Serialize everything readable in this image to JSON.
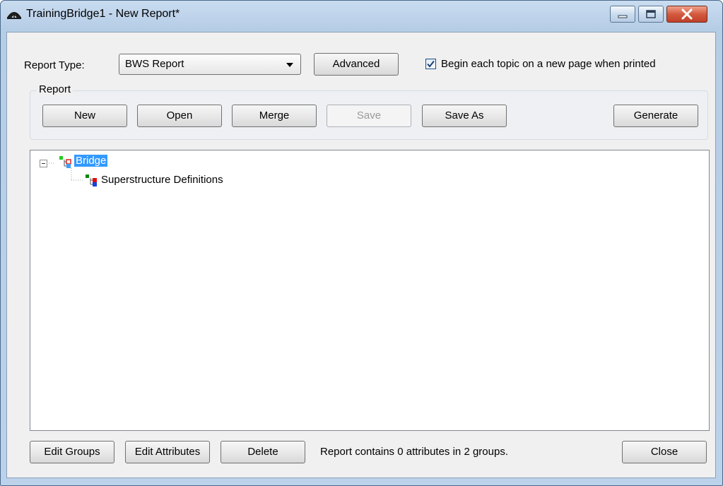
{
  "window": {
    "title": "TrainingBridge1 - New Report*",
    "app_icon": "bridge-arch-icon",
    "controls": [
      "minimize-icon",
      "maximize-icon",
      "close-icon"
    ]
  },
  "report_type": {
    "label": "Report Type:",
    "value": "BWS Report",
    "advanced_label": "Advanced",
    "new_page_checkbox": {
      "label": "Begin each topic on a new page when printed",
      "checked": true
    }
  },
  "report_group": {
    "label": "Report",
    "buttons": {
      "new": "New",
      "open": "Open",
      "merge": "Merge",
      "save": "Save",
      "save_as": "Save As",
      "generate": "Generate"
    },
    "save_enabled": false
  },
  "tree": {
    "root": {
      "label": "Bridge",
      "expanded": true,
      "selected": true,
      "icon": "group-node-icon"
    },
    "children": [
      {
        "label": "Superstructure Definitions",
        "icon": "group-node-icon"
      }
    ]
  },
  "footer": {
    "edit_groups": "Edit Groups",
    "edit_attributes": "Edit Attributes",
    "delete": "Delete",
    "status": "Report contains 0 attributes in 2 groups.",
    "close": "Close"
  },
  "colors": {
    "selection": "#3399ff",
    "title_bar": "#bcd2ea",
    "close_button": "#c2402a"
  }
}
